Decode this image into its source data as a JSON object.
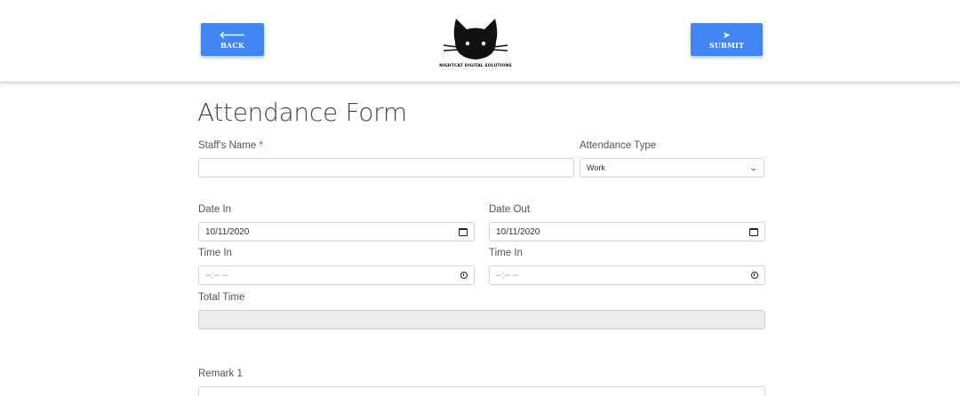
{
  "header": {
    "back_label": "BACK",
    "back_icon": "arrow-left-icon",
    "submit_label": "SUBMIT",
    "submit_icon": "paper-plane-icon",
    "logo_text": "NIGHTCAT DIGITAL SOLUTIONS",
    "accent_color": "#4285f4"
  },
  "form": {
    "title": "Attendance Form",
    "staff_name": {
      "label": "Staff's Name",
      "required_mark": "*",
      "value": ""
    },
    "attendance_type": {
      "label": "Attendance Type",
      "selected": "Work"
    },
    "date_in": {
      "label": "Date In",
      "value": "10/11/2020"
    },
    "date_out": {
      "label": "Date Out",
      "value": "10/11/2020"
    },
    "time_in": {
      "label": "Time In",
      "placeholder": "--:-- --"
    },
    "time_out": {
      "label": "Time In",
      "placeholder": "--:-- --"
    },
    "total_time": {
      "label": "Total Time",
      "value": ""
    },
    "remark1": {
      "label": "Remark 1",
      "value": ""
    }
  }
}
